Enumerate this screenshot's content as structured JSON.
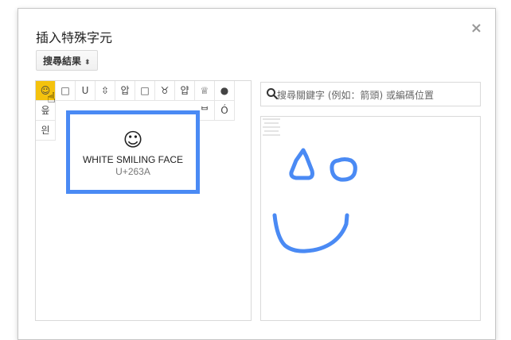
{
  "dialog": {
    "title": "插入特殊字元",
    "close_label": "×",
    "dropdown": {
      "label": "搜尋結果",
      "arrow": "⬍"
    }
  },
  "grid": {
    "rows": [
      [
        "☺",
        "□",
        "ᑌ",
        "⇳",
        "압",
        "□",
        "♉",
        "얍",
        "♕",
        "●"
      ],
      [
        "읖",
        "",
        "",
        "",
        "",
        "",
        "",
        "",
        "ᄇ",
        "Ó"
      ],
      [
        "읜",
        "",
        "",
        "",
        "",
        "",
        "",
        "",
        "",
        ""
      ]
    ]
  },
  "tooltip": {
    "glyph": "☺",
    "name": "WHITE SMILING FACE",
    "code": "U+263A"
  },
  "search": {
    "placeholder": "搜尋關鍵字 (例如：箭頭) 或編碼位置"
  },
  "colors": {
    "accent": "#4a8af4",
    "selected_cell": "#f4c20d"
  }
}
